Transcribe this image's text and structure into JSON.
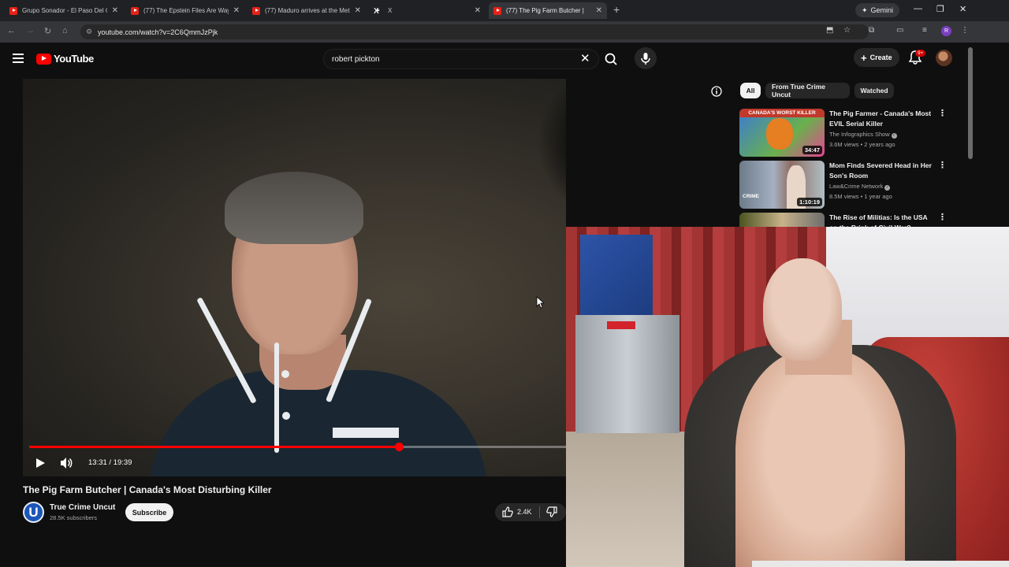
{
  "browser": {
    "tabs": [
      {
        "title": "Grupo Sonador - El Paso Del Gi",
        "icon": "youtube-icon",
        "active": false
      },
      {
        "title": "(77) The Epstein Files Are Way",
        "icon": "youtube-icon",
        "active": false
      },
      {
        "title": "(77) Maduro arrives at the Met",
        "icon": "youtube-icon",
        "active": false
      },
      {
        "title": "X",
        "icon": "x-icon",
        "active": false
      },
      {
        "title": "(77) The Pig Farm Butcher |",
        "icon": "youtube-icon",
        "active": true
      }
    ],
    "gemini_label": "Gemini",
    "url": "youtube.com/watch?v=2C6QmmJzPjk",
    "profile_initial": "R"
  },
  "youtube": {
    "logo_text": "YouTube",
    "search_value": "robert pickton",
    "create_label": "Create",
    "notification_badge": "9+"
  },
  "player": {
    "time": "13:31 / 19:39",
    "progress_fraction": 0.688
  },
  "video": {
    "title": "The Pig Farm Butcher | Canada's Most Disturbing Killer",
    "channel": {
      "initial": "U",
      "name": "True Crime Uncut",
      "subscribers": "28.5K subscribers"
    },
    "subscribe_label": "Subscribe",
    "likes": "2.4K"
  },
  "sidebar": {
    "chips": [
      {
        "label": "All",
        "active": true
      },
      {
        "label": "From True Crime Uncut",
        "active": false
      },
      {
        "label": "Watched",
        "active": false
      }
    ],
    "items": [
      {
        "title": "The Pig Farmer - Canada's Most EVIL Serial Killer",
        "channel": "The Infographics Show",
        "meta": "3.6M views • 2 years ago",
        "duration": "34:47",
        "thumb_caption": "CANADA'S WORST KILLER"
      },
      {
        "title": "Mom Finds Severed Head in Her Son's Room",
        "channel": "Law&Crime Network",
        "meta": "8.5M views • 1 year ago",
        "duration": "1:10:19",
        "thumb_caption": "CRIME"
      },
      {
        "title": "The Rise of Militias: Is the USA on the Brink of Civil War?",
        "channel": "",
        "meta": "",
        "duration": "",
        "thumb_caption": ""
      }
    ]
  },
  "colors": {
    "youtube_red": "#ff0000",
    "background": "#0f0f0f",
    "chip": "#272727"
  }
}
